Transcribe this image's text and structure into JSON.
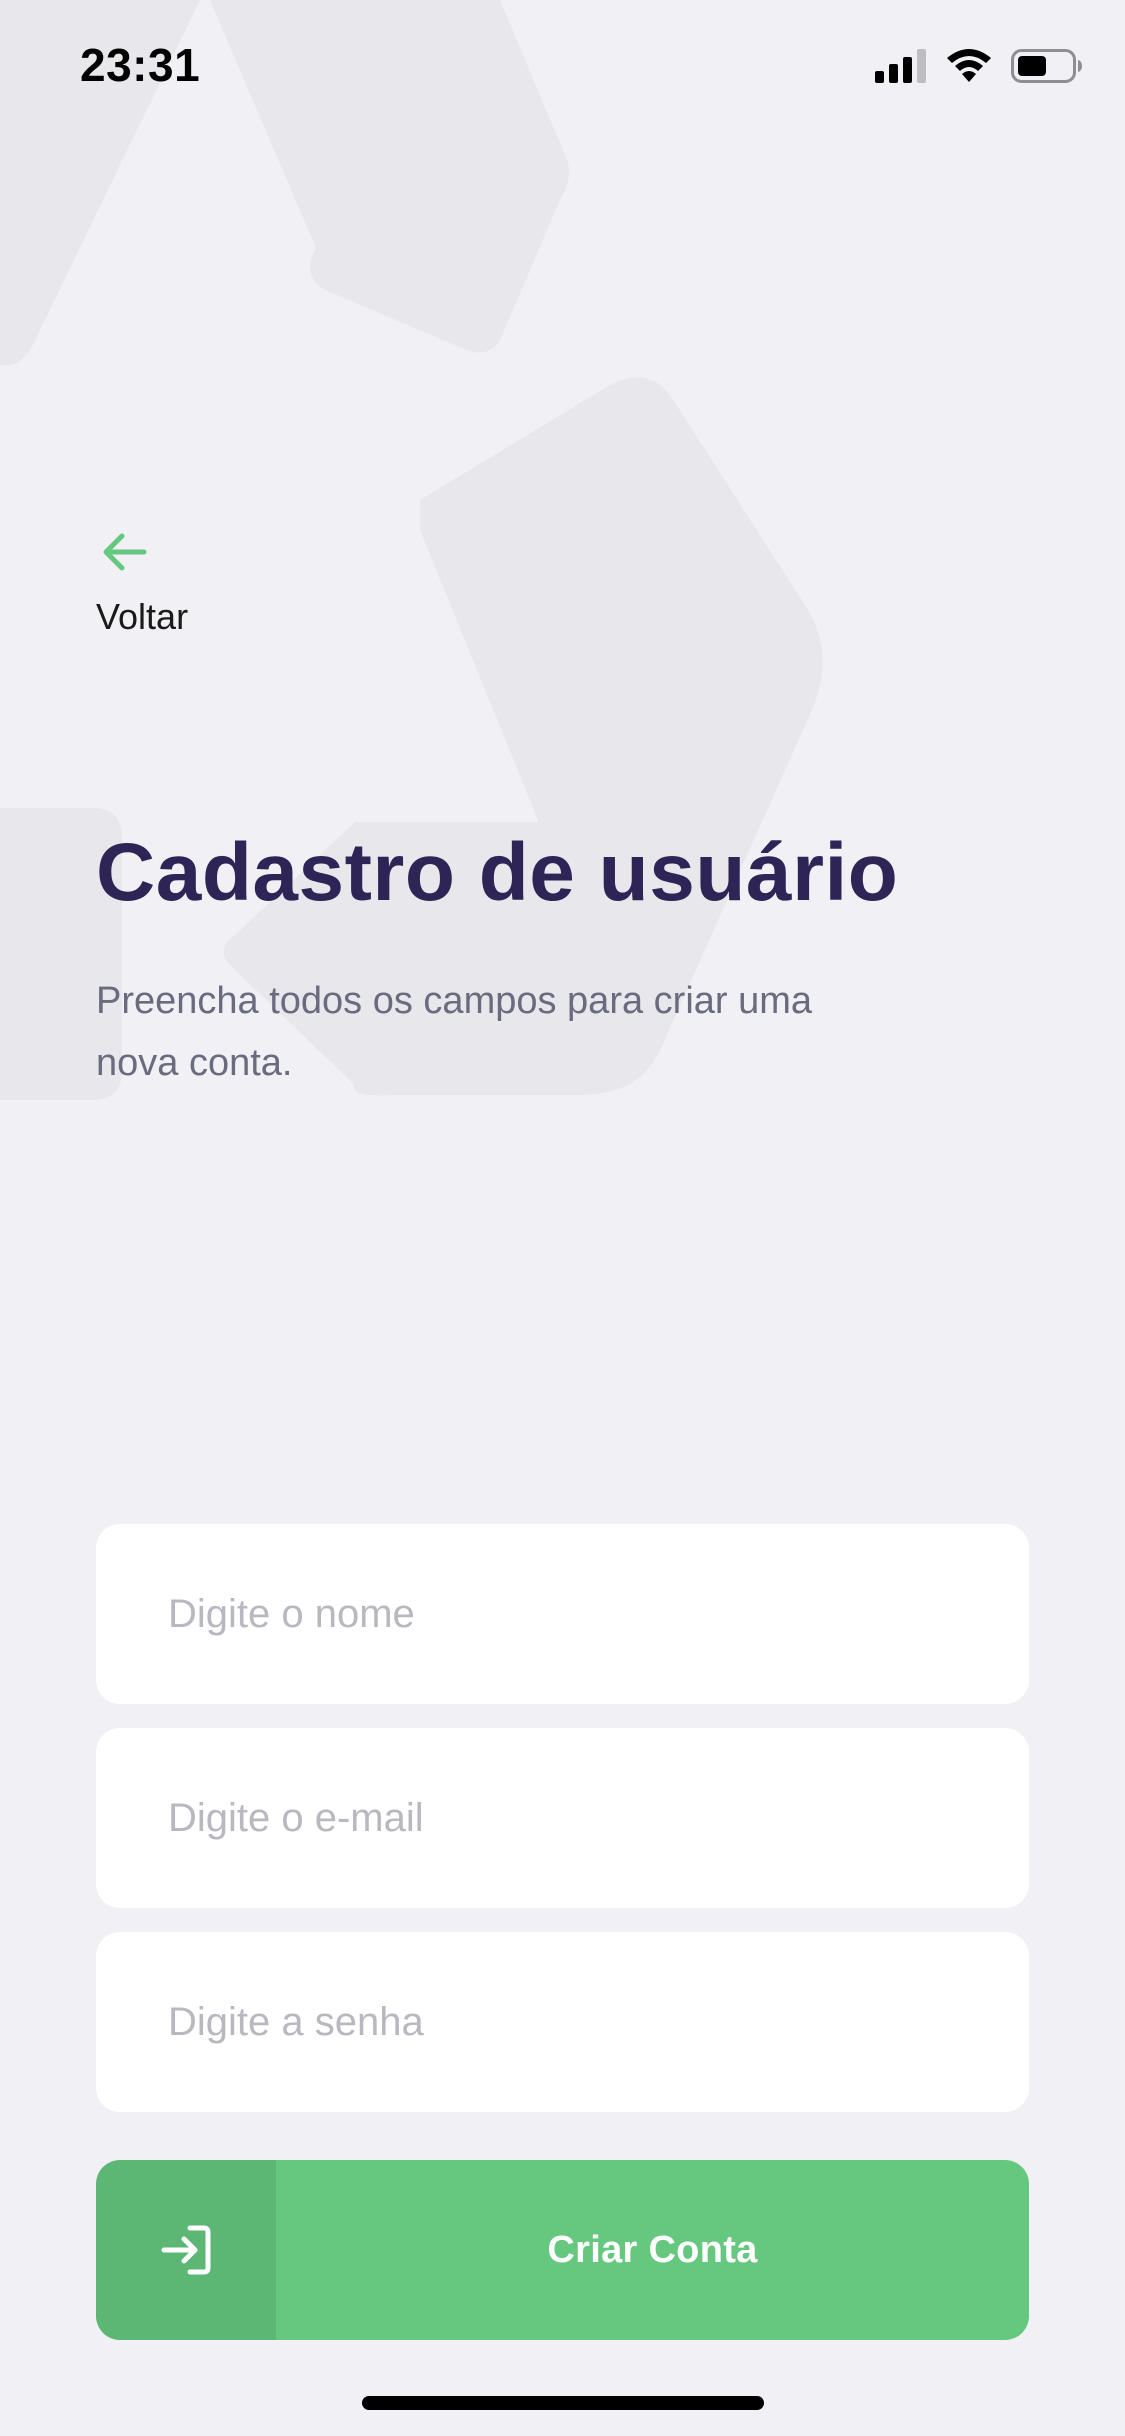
{
  "status_bar": {
    "time": "23:31",
    "icons": [
      "signal-icon",
      "wifi-icon",
      "battery-icon"
    ]
  },
  "back": {
    "icon": "arrow-left-icon",
    "label": "Voltar"
  },
  "header": {
    "title": "Cadastro de usuário",
    "subtitle": "Preencha todos os campos para criar uma nova conta."
  },
  "form": {
    "name_placeholder": "Digite o nome",
    "email_placeholder": "Digite o e-mail",
    "password_placeholder": "Digite a senha",
    "name_value": "",
    "email_value": "",
    "password_value": ""
  },
  "submit": {
    "icon": "log-in-icon",
    "label": "Criar Conta"
  },
  "colors": {
    "background": "#F0F0F5",
    "title": "#2E2556",
    "accent": "#66C77F",
    "accent_dark": "#5CB775",
    "subtitle": "#6B6B80",
    "placeholder": "#B8B8C0"
  }
}
